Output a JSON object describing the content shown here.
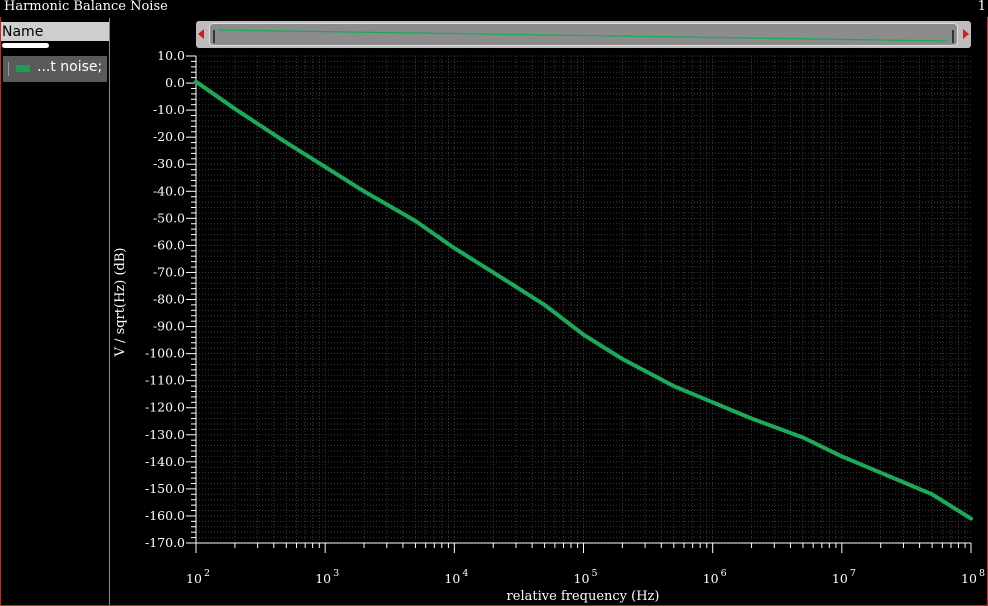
{
  "window": {
    "title": "Harmonic Balance Noise",
    "corner_text": "1"
  },
  "sidebar": {
    "header": "Name",
    "legend_items": [
      {
        "label": "...t noise;",
        "color": "#1a9f55"
      }
    ]
  },
  "colors": {
    "series": "#1aaa5a",
    "grid": "#3a3a3a",
    "axis": "#ffffff",
    "border": "#c0262b"
  },
  "chart_data": {
    "type": "line",
    "title": "",
    "xlabel": "relative frequency (Hz)",
    "ylabel": "V / sqrt(Hz) (dB)",
    "xscale": "log",
    "xlim": [
      100,
      100000000
    ],
    "ylim": [
      -170,
      10
    ],
    "grid": true,
    "x_tick_bases": [
      "10",
      "10",
      "10",
      "10",
      "10",
      "10",
      "10"
    ],
    "x_tick_exps": [
      "2",
      "3",
      "4",
      "5",
      "6",
      "7",
      "8"
    ],
    "y_ticks": [
      "10.0",
      "0.0",
      "-10.0",
      "-20.0",
      "-30.0",
      "-40.0",
      "-50.0",
      "-60.0",
      "-70.0",
      "-80.0",
      "-90.0",
      "-100.0",
      "-110.0",
      "-120.0",
      "-130.0",
      "-140.0",
      "-150.0",
      "-160.0",
      "-170.0"
    ],
    "series": [
      {
        "x": [
          100,
          200,
          500,
          1000,
          2000,
          5000,
          10000,
          20000,
          50000,
          100000,
          200000,
          500000,
          1000000,
          2000000,
          5000000,
          10000000,
          20000000,
          50000000,
          100000000
        ],
        "y": [
          0.5,
          -9.5,
          -22,
          -31,
          -40,
          -51,
          -61,
          -70,
          -82,
          -93,
          -102,
          -112,
          -118,
          -124,
          -131,
          -138,
          -144,
          -152,
          -161
        ]
      }
    ]
  }
}
